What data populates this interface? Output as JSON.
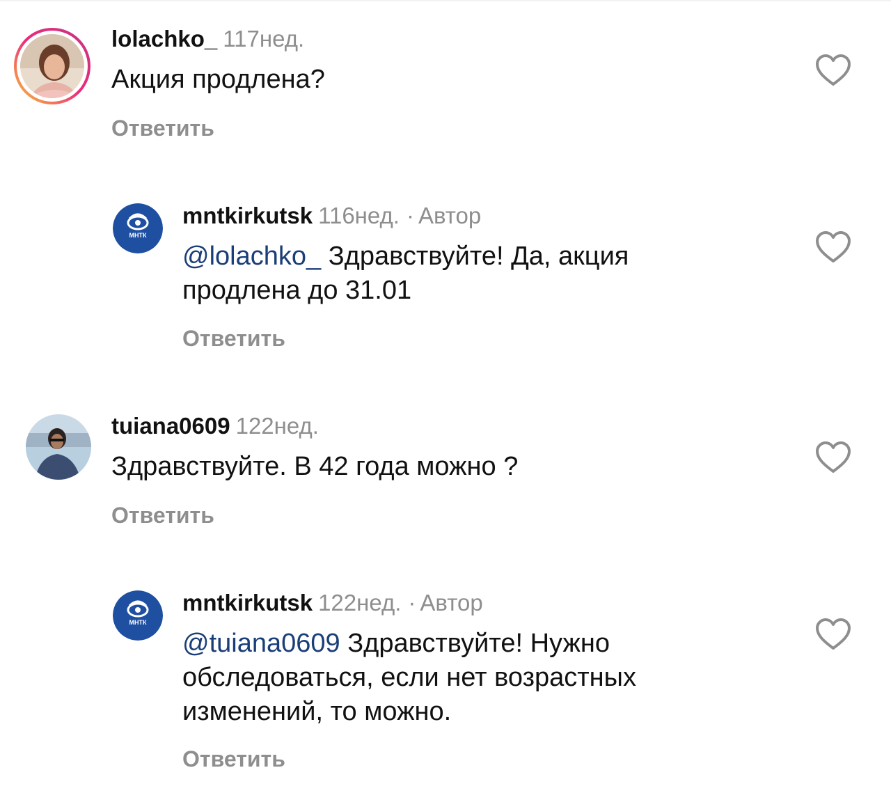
{
  "comments": [
    {
      "username": "lolachko_",
      "time": "117нед.",
      "text": "Акция продлена?",
      "reply_label": "Ответить",
      "avatar": "user-photo-avatar",
      "has_story_ring": true
    },
    {
      "username": "mntkirkutsk",
      "time": "116нед.",
      "dot": "·",
      "author_label": "Автор",
      "mention": "@lolachko_",
      "text": "Здравствуйте! Да, акция продлена до 31.01",
      "reply_label": "Ответить",
      "avatar": "mntk-logo-avatar",
      "logo_text": "МНТК"
    },
    {
      "username": "tuiana0609",
      "time": "122нед.",
      "text": "Здравствуйте. В 42 года можно ?",
      "reply_label": "Ответить",
      "avatar": "user-photo-avatar"
    },
    {
      "username": "mntkirkutsk",
      "time": "122нед.",
      "dot": "·",
      "author_label": "Автор",
      "mention": "@tuiana0609",
      "text": "Здравствуйте! Нужно обследоваться, если нет возрастных изменений, то можно.",
      "reply_label": "Ответить",
      "avatar": "mntk-logo-avatar",
      "logo_text": "МНТК"
    }
  ],
  "colors": {
    "mention": "#1a3e78",
    "muted": "#8e8e8e",
    "logo_blue": "#1e4fa0"
  }
}
